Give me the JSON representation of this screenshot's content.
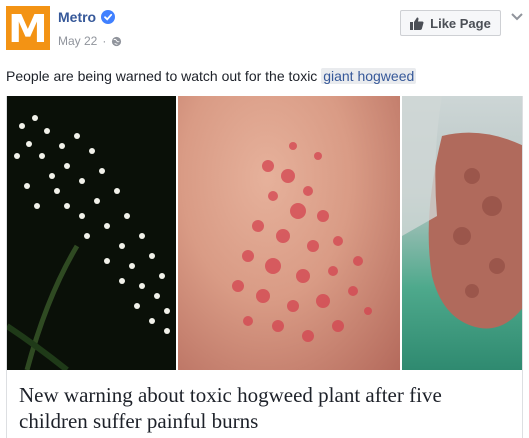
{
  "header": {
    "page_name": "Metro",
    "logo_letter": "M",
    "date": "May 22",
    "like_label": "Like Page",
    "icons": [
      "verified-badge-icon",
      "globe-icon",
      "thumbs-up-icon",
      "chevron-down-icon"
    ]
  },
  "post": {
    "text": "People are being warned to watch out for the toxic ",
    "link_text": "giant hogweed"
  },
  "link_preview": {
    "title": "New warning about toxic hogweed plant after five children suffer painful burns",
    "images": [
      "hogweed-flowers-photo",
      "rash-on-skin-photo",
      "burned-hand-photo"
    ]
  },
  "colors": {
    "brand": "#f39314",
    "link": "#365899",
    "muted": "#90949c"
  }
}
